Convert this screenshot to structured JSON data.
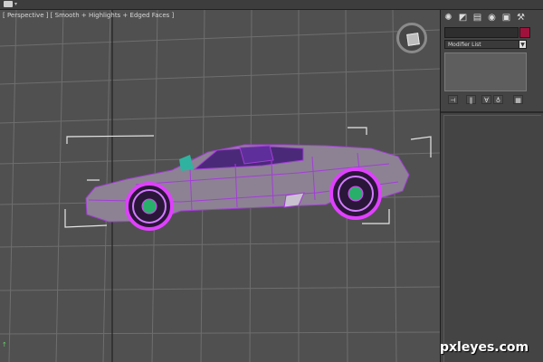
{
  "viewport": {
    "label": "[ Perspective ] [ Smooth + Highlights + Edged Faces ]"
  },
  "command_panel": {
    "tabs": [
      "create-icon",
      "modify-icon",
      "hierarchy-icon",
      "motion-icon",
      "display-icon",
      "utilities-icon"
    ],
    "modifier_list_label": "Modifier List",
    "object_color": "#a0123c"
  },
  "colors": {
    "viewport_background": "#505050",
    "grid": "#6c6c6c",
    "wireframe": "#a43cd8",
    "rim_glow": "#e040ff",
    "car_body": "#8d8294"
  },
  "watermark": "pxleyes.com"
}
